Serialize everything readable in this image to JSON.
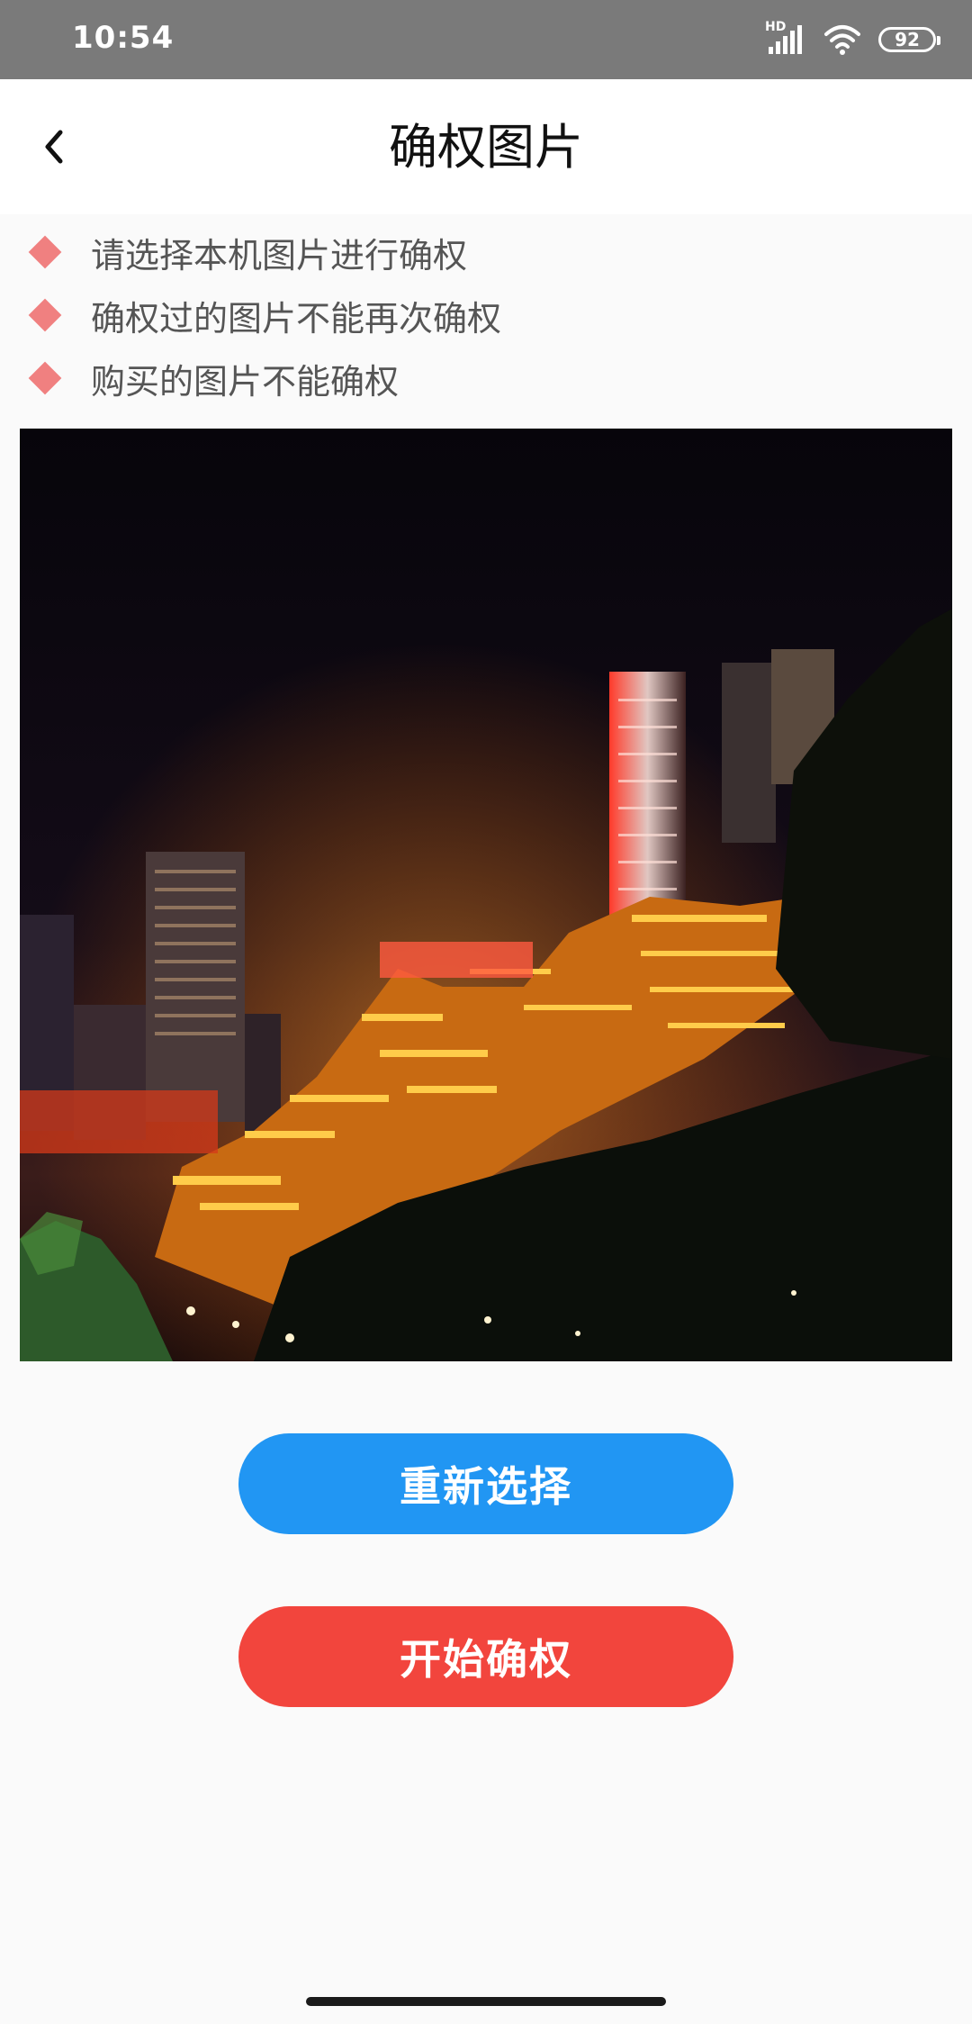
{
  "status_bar": {
    "time": "10:54",
    "network_label": "HD",
    "battery_level": "92"
  },
  "header": {
    "title": "确权图片"
  },
  "notices": [
    "请选择本机图片进行确权",
    "确权过的图片不能再次确权",
    "购买的图片不能确权"
  ],
  "colors": {
    "accent_blue": "#2196f3",
    "accent_red": "#f2453d",
    "notice_marker": "#f08080"
  },
  "buttons": {
    "reselect_label": "重新选择",
    "start_label": "开始确权"
  }
}
